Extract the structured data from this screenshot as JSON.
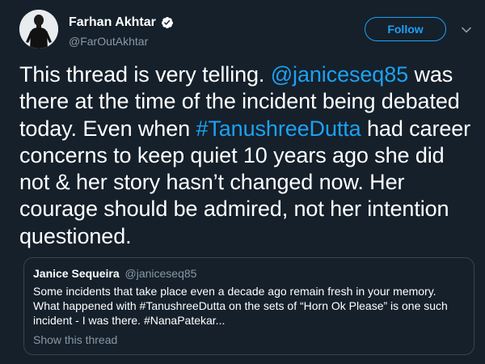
{
  "author": {
    "name": "Farhan Akhtar",
    "handle": "@FarOutAkhtar",
    "verified": true
  },
  "follow_button": {
    "label": "Follow"
  },
  "tweet": {
    "text_1": "This thread is very telling. ",
    "mention": "@janiceseq85",
    "text_2": " was there at the time of the incident being debated today. Even when ",
    "hashtag": "#TanushreeDutta",
    "text_3": " had career concerns to keep quiet 10 years ago she did not & her story hasn’t changed now. Her courage should be admired, not her intention questioned."
  },
  "quoted_tweet": {
    "name": "Janice Sequeira",
    "handle": "@janiceseq85",
    "text": "Some incidents that take place even a decade ago remain fresh in your memory. What happened with #TanushreeDutta on the sets of “Horn Ok Please” is one such incident - I was there. #NanaPatekar...",
    "show_thread": "Show this thread"
  },
  "colors": {
    "background": "#15202b",
    "accent": "#1da1f2",
    "secondary_text": "#8899a6",
    "border": "#38444d"
  },
  "icons": {
    "verified": "verified-badge-icon",
    "caret": "chevron-down-icon"
  }
}
